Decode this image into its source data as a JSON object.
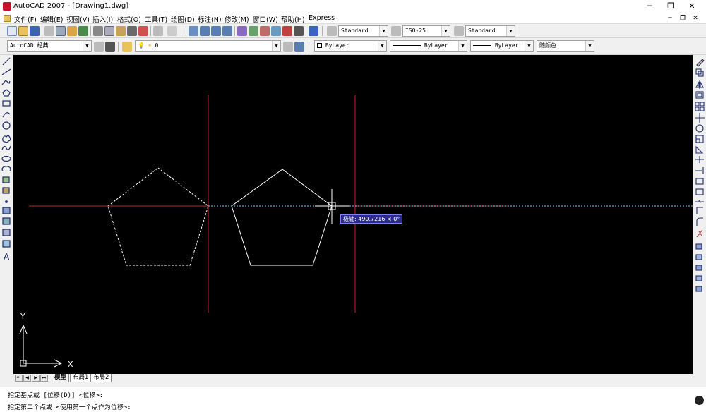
{
  "window": {
    "title": "AutoCAD 2007 - [Drawing1.dwg]",
    "min_label": "─",
    "restore_label": "❐",
    "close_label": "✕",
    "mdi_min_label": "─",
    "mdi_restore_label": "❐",
    "mdi_close_label": "✕"
  },
  "menu": [
    "文件(F)",
    "编辑(E)",
    "视图(V)",
    "插入(I)",
    "格式(O)",
    "工具(T)",
    "绘图(D)",
    "标注(N)",
    "修改(M)",
    "窗口(W)",
    "帮助(H)",
    "Express"
  ],
  "toolbar1": {
    "text_style": "Standard",
    "dim_style": "ISO-25",
    "table_style": "Standard"
  },
  "toolbar2": {
    "workspace": "AutoCAD 经典",
    "layer": "0",
    "color": "ByLayer",
    "linetype": "ByLayer",
    "lineweight": "ByLayer",
    "plot_style": "随颜色"
  },
  "icons": {
    "left_tools": [
      "line-icon",
      "construction-line-icon",
      "polyline-icon",
      "polygon-icon",
      "rectangle-icon",
      "arc-icon",
      "circle-icon",
      "revision-cloud-icon",
      "spline-icon",
      "ellipse-icon",
      "ellipse-arc-icon",
      "insert-block-icon",
      "make-block-icon",
      "point-icon",
      "hatch-icon",
      "gradient-icon",
      "region-icon",
      "table-icon",
      "multiline-text-icon"
    ],
    "right_tools": [
      "erase-icon",
      "copy-icon",
      "mirror-icon",
      "offset-icon",
      "array-icon",
      "move-icon",
      "rotate-icon",
      "scale-icon",
      "stretch-icon",
      "trim-icon",
      "extend-icon",
      "break-at-point-icon",
      "break-icon",
      "join-icon",
      "chamfer-icon",
      "fillet-icon",
      "explode-icon",
      "draworder-icon",
      "bring-front-icon",
      "send-back-icon",
      "bring-above-icon",
      "send-under-icon"
    ]
  },
  "canvas": {
    "tooltip": "极轴: 490.7216 < 0°",
    "ucs_x": "X",
    "ucs_y": "Y"
  },
  "tabs": {
    "nav": [
      "⏮",
      "◀",
      "▶",
      "⏭"
    ],
    "items": [
      "模型",
      "布局1",
      "布局2"
    ]
  },
  "command": {
    "line1": "指定基点或 [位移(D)] <位移>:",
    "line2": "指定第二个点或 <使用第一个点作为位移>:"
  },
  "colors": {
    "canvas": "#000000",
    "crosshair_red": "#cc2222",
    "polar_tracking": "#66ccff",
    "drawing_white": "#ffffff"
  }
}
